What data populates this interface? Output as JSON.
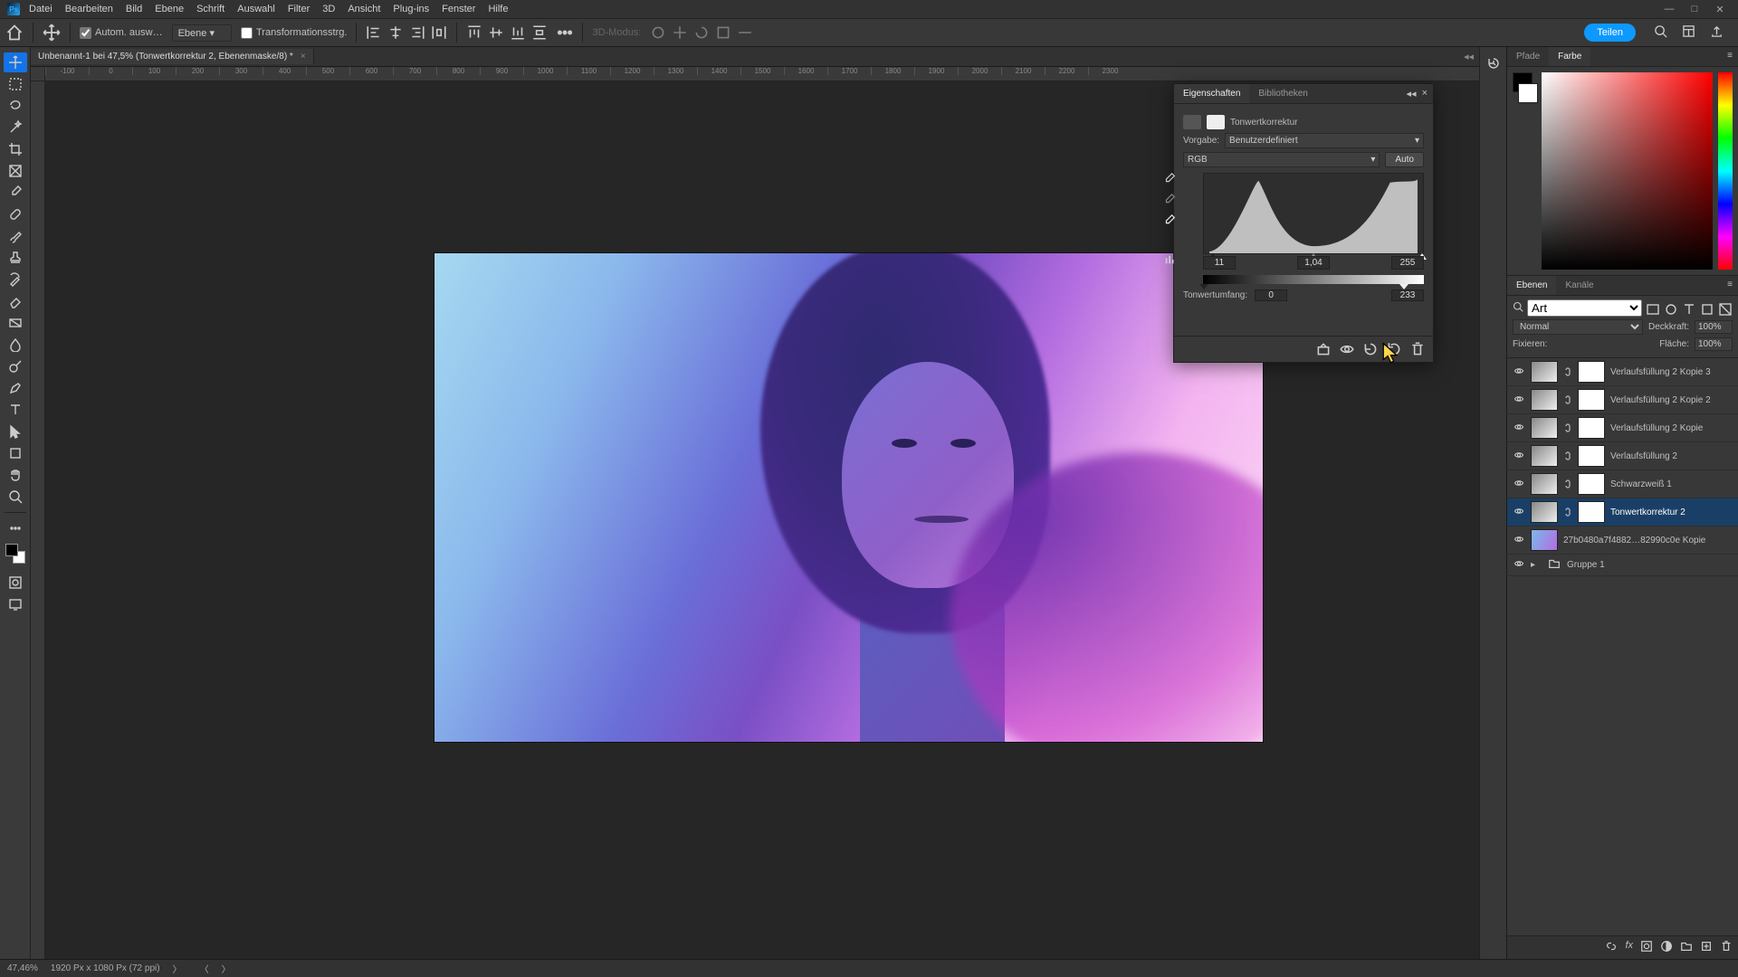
{
  "menu": [
    "Datei",
    "Bearbeiten",
    "Bild",
    "Ebene",
    "Schrift",
    "Auswahl",
    "Filter",
    "3D",
    "Ansicht",
    "Plug-ins",
    "Fenster",
    "Hilfe"
  ],
  "options": {
    "auto_select": "Autom. ausw…",
    "layer_target": "Ebene",
    "transform": "Transformationsstrg.",
    "mode3d": "3D-Modus:"
  },
  "share_label": "Teilen",
  "doc_tab": "Unbenannt-1 bei 47,5% (Tonwertkorrektur 2, Ebenenmaske/8) *",
  "ruler_marks": [
    "-100",
    "0",
    "100",
    "200",
    "300",
    "400",
    "500",
    "600",
    "700",
    "800",
    "900",
    "1000",
    "1100",
    "1200",
    "1300",
    "1400",
    "1500",
    "1600",
    "1700",
    "1800",
    "1900",
    "2000",
    "2100",
    "2200",
    "2300"
  ],
  "props": {
    "tab1": "Eigenschaften",
    "tab2": "Bibliotheken",
    "adj_name": "Tonwertkorrektur",
    "preset_lbl": "Vorgabe:",
    "preset_val": "Benutzerdefiniert",
    "channel": "RGB",
    "auto": "Auto",
    "in_shadow": "11",
    "in_gamma": "1,04",
    "in_high": "255",
    "out_label": "Tonwertumfang:",
    "out_low": "0",
    "out_high": "233"
  },
  "color_tabs": {
    "t1": "Pfade",
    "t2": "Farbe"
  },
  "layers": {
    "tab1": "Ebenen",
    "tab2": "Kanäle",
    "search_ph": "Art",
    "blend": "Normal",
    "opacity_lbl": "Deckkraft:",
    "opacity_val": "100%",
    "lock_lbl": "Fixieren:",
    "fill_lbl": "Fläche:",
    "fill_val": "100%",
    "items": [
      {
        "name": "Verlaufsfüllung 2 Kopie 3",
        "type": "grad"
      },
      {
        "name": "Verlaufsfüllung 2 Kopie 2",
        "type": "grad"
      },
      {
        "name": "Verlaufsfüllung 2 Kopie",
        "type": "grad"
      },
      {
        "name": "Verlaufsfüllung 2",
        "type": "grad"
      },
      {
        "name": "Schwarzweiß 1",
        "type": "adj"
      },
      {
        "name": "Tonwertkorrektur 2",
        "type": "adj",
        "selected": true
      },
      {
        "name": "27b0480a7f4882…82990c0e  Kopie",
        "type": "img"
      },
      {
        "name": "Gruppe 1",
        "type": "group"
      }
    ]
  },
  "status": {
    "zoom": "47,46%",
    "info": "1920 Px x 1080 Px (72 ppi)"
  }
}
